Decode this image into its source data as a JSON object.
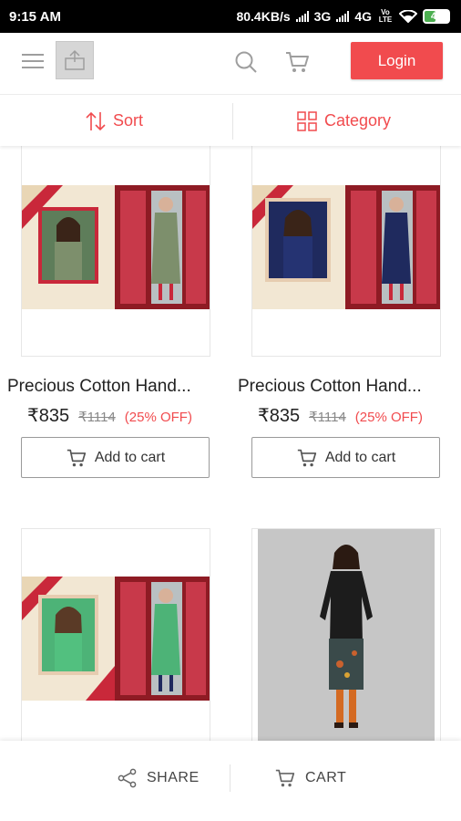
{
  "status_bar": {
    "time": "9:15 AM",
    "network_speed": "80.4KB/s",
    "network_type_1": "3G",
    "network_type_2": "4G",
    "volte_label": "Vo LTE",
    "battery_level": "47"
  },
  "header": {
    "login_label": "Login",
    "accent_color": "#f14b4e"
  },
  "filter_bar": {
    "sort_label": "Sort",
    "category_label": "Category"
  },
  "products": [
    {
      "name": "Precious Cotton Hand...",
      "price": "₹835",
      "mrp": "₹1114",
      "discount": "(25% OFF)",
      "add_to_cart_label": "Add to cart",
      "image": "green-kurti-catalog"
    },
    {
      "name": "Precious Cotton Hand...",
      "price": "₹835",
      "mrp": "₹1114",
      "discount": "(25% OFF)",
      "add_to_cart_label": "Add to cart",
      "image": "navy-kurti-catalog"
    },
    {
      "name": "",
      "price": "",
      "mrp": "",
      "discount": "",
      "add_to_cart_label": "",
      "image": "mint-kurti-catalog"
    },
    {
      "name": "",
      "price": "",
      "mrp": "",
      "discount": "",
      "add_to_cart_label": "",
      "image": "black-floral-kurti"
    }
  ],
  "bottom_bar": {
    "share_label": "SHARE",
    "cart_label": "CART"
  }
}
